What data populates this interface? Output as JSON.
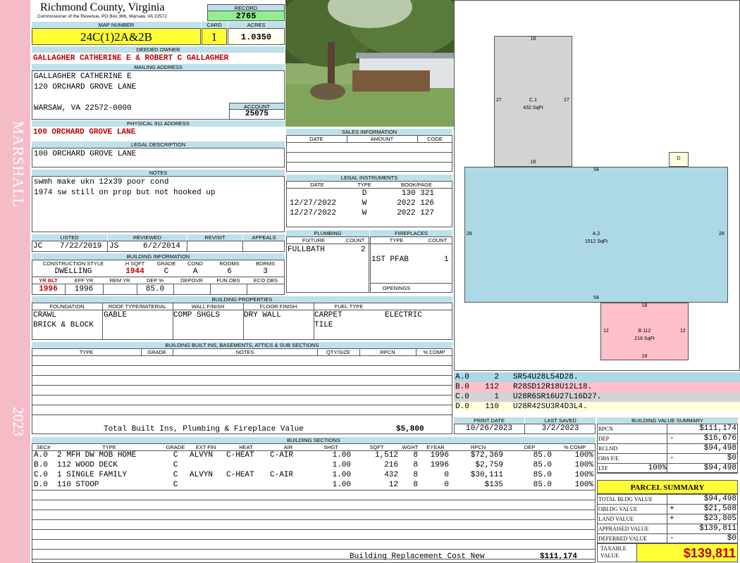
{
  "county": "Richmond County, Virginia",
  "commissioner": "Commissioner of the Revenue, PO Box 366, Warsaw, VA 22572",
  "record_label": "RECORD",
  "record": "2765",
  "map_label": "MAP NUMBER",
  "map_number": "24C(1)2A&2B",
  "card_label": "CARD",
  "card": "1",
  "acres_label": "ACRES",
  "acres": "1.0350",
  "owner_label": "DEEDED OWNER",
  "owner": "GALLAGHER CATHERINE E & ROBERT C GALLAGHER",
  "mailing_label": "MAILING ADDRESS",
  "mailing": [
    "GALLAGHER CATHERINE E",
    "120 ORCHARD GROVE LANE",
    "",
    "WARSAW, VA 22572-0000"
  ],
  "account_label": "ACCOUNT",
  "account": "25075",
  "physical_label": "PHYSICAL 911 ADDRESS",
  "physical": "100 ORCHARD GROVE LANE",
  "legal_label": "LEGAL DESCRIPTION",
  "legal": "100 ORCHARD GROVE LANE",
  "notes_label": "NOTES",
  "notes": [
    "swmh make ukn 12x39 poor cond",
    "1974 sw still on prop but not hooked up"
  ],
  "side_district": "MARSHALL",
  "side_year": "2023",
  "listing": {
    "headers": [
      "LISTED",
      "REVIEWED",
      "REVISIT",
      "APPEALS"
    ],
    "listed_by": "JC",
    "listed_date": "7/22/2019",
    "reviewed_by": "JS",
    "reviewed_date": "6/2/2014"
  },
  "building_info": {
    "title": "BUILDING INFORMATION",
    "headers1": [
      "CONSTRUCTION STYLE",
      "H SQFT",
      "GRADE",
      "COND",
      "ROOMS",
      "BDRMS"
    ],
    "values1": [
      "DWELLING",
      "1944",
      "C",
      "A",
      "6",
      "3"
    ],
    "headers2": [
      "YR BLT",
      "EFF YR",
      "REM YR",
      "DEP %",
      "DEPOVR",
      "FUN OBS",
      "ECO OBS"
    ],
    "values2": [
      "1996",
      "1996",
      "",
      "85.0",
      "",
      "",
      ""
    ]
  },
  "sales": {
    "title": "SALES INFORMATION",
    "headers": [
      "DATE",
      "AMOUNT",
      "CODE"
    ]
  },
  "legal_instruments": {
    "title": "LEGAL INSTRUMENTS",
    "headers": [
      "DATE",
      "TYPE",
      "BOOK/PAGE"
    ],
    "rows": [
      [
        "",
        "D",
        "130 321"
      ],
      [
        "12/27/2022",
        "W",
        "2022 126"
      ],
      [
        "12/27/2022",
        "W",
        "2022 127"
      ]
    ]
  },
  "plumbing": {
    "title": "PLUMBING",
    "headers": [
      "FIXTURE",
      "COUNT"
    ],
    "rows": [
      [
        "FULLBATH",
        "2"
      ]
    ]
  },
  "fireplaces": {
    "title": "FIREPLACES",
    "headers": [
      "TYPE",
      "COUNT"
    ],
    "rows": [
      [
        "1ST PFAB",
        "1"
      ]
    ],
    "openings": "OPENINGS"
  },
  "properties": {
    "title": "BUILDING PROPERTIES",
    "headers": [
      "FOUNDATION",
      "ROOF TYPE/MATERIAL",
      "WALL FINISH",
      "FLOOR FINISH",
      "FUEL TYPE"
    ],
    "foundation": [
      "CRAWL",
      "BRICK & BLOCK"
    ],
    "roof_type": "GABLE",
    "roof_material": "COMP SHGLS",
    "wall": "DRY WALL",
    "floor": [
      "CARPET",
      "TILE"
    ],
    "fuel": "ELECTRIC"
  },
  "builtins": {
    "title": "BUILDING BUILT INS, BASEMENTS, ATTICS & SUB SECTIONS",
    "headers": [
      "TYPE",
      "GRADE",
      "NOTES",
      "QTY/SIZE",
      "RPCN",
      "% COMP"
    ],
    "total_label": "Total Built Ins, Plumbing & Fireplace Value",
    "total": "$5,800"
  },
  "print": {
    "print_label": "PRINT DATE",
    "saved_label": "LAST SAVED",
    "print_date": "10/26/2023",
    "last_saved": "3/2/2023"
  },
  "sections": {
    "title": "BUILDING SECTIONS",
    "headers": [
      "SEC#",
      "TYPE",
      "GRADE",
      "EXT FIN",
      "HEAT",
      "AIR",
      "SHGT",
      "SQFT",
      "WGHT",
      "EYEAR",
      "RPCN",
      "DEP",
      "% COMP"
    ],
    "rows": [
      [
        "A.0",
        "2 MFH DW MOB HOME",
        "C",
        "ALVYN",
        "C-HEAT",
        "C-AIR",
        "1.00",
        "1,512",
        "8",
        "1996",
        "$72,369",
        "85.0",
        "100%"
      ],
      [
        "B.0",
        "112 WOOD DECK",
        "C",
        "",
        "",
        "",
        "1.00",
        "216",
        "8",
        "1996",
        "$2,759",
        "85.0",
        "100%"
      ],
      [
        "C.0",
        "1 SINGLE FAMILY",
        "C",
        "ALVYN",
        "C-HEAT",
        "C-AIR",
        "1.00",
        "432",
        "8",
        "0",
        "$30,111",
        "85.0",
        "100%"
      ],
      [
        "D.0",
        "110 STOOP",
        "C",
        "",
        "",
        "",
        "1.00",
        "12",
        "8",
        "0",
        "$135",
        "85.0",
        "100%"
      ]
    ],
    "replacement_label": "Building Replacement Cost New",
    "replacement": "$111,174"
  },
  "sketch": {
    "c1_label": "C.1",
    "c1_area": "432 SqFt",
    "c1_top": "16",
    "c1_left": "27",
    "c1_right": "27",
    "c1_bottom": "16",
    "a2_label": "A.2",
    "a2_area": "1512 SqFt",
    "a2_top": "54",
    "a2_left": "28",
    "a2_right": "28",
    "a2_bottom": "54",
    "b_label": "B.112",
    "b_area": "216 SqFt",
    "b_top": "18",
    "b_left": "12",
    "b_right": "12",
    "b_bottom": "18",
    "d_label": "D"
  },
  "sketch_legend": [
    {
      "id": "A.0",
      "code": "2",
      "path": "SR54U28L54D28.",
      "color": "#add8e6"
    },
    {
      "id": "B.0",
      "code": "112",
      "path": "R28SD12R18U12L18.",
      "color": "#ffc0cb"
    },
    {
      "id": "C.0",
      "code": "1",
      "path": "U28R6SR16U27L16D27.",
      "color": "#d3d3d3"
    },
    {
      "id": "D.0",
      "code": "110",
      "path": "U28R42SU3R4D3L4.",
      "color": "#ffffe0"
    }
  ],
  "value_summary": {
    "title": "BUILDING VALUE SUMMARY",
    "rows": [
      [
        "RPCN",
        "",
        "$111,174"
      ],
      [
        "DEP",
        "-",
        "$16,676"
      ],
      [
        "RCLND",
        "",
        "$94,498"
      ],
      [
        "OBS F/E",
        "-",
        "$0"
      ],
      [
        "LTF",
        "100%",
        "$94,498"
      ]
    ]
  },
  "parcel": {
    "title": "PARCEL SUMMARY",
    "rows": [
      [
        "TOTAL BLDG VALUE",
        "",
        "$94,498"
      ],
      [
        "OBLDG VALUE",
        "+",
        "$21,508"
      ],
      [
        "LAND VALUE",
        "+",
        "$23,805"
      ],
      [
        "APPRAISED VALUE",
        "",
        "$139,811"
      ],
      [
        "DEFERRED VALUE",
        "-",
        "$0"
      ]
    ],
    "taxable_label": "TAXABLE VALUE",
    "taxable": "$139,811"
  },
  "colors": {
    "header": "#bfe0ea",
    "yellow": "#ffff33",
    "record_green": "#90ee90",
    "side_pink": "#f5bcc8",
    "red": "#c00000"
  }
}
